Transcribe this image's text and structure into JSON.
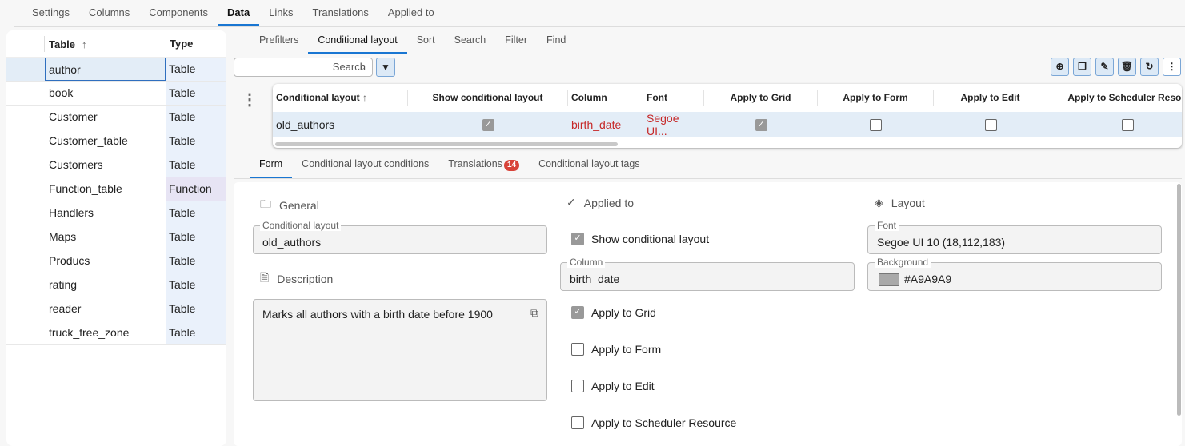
{
  "top_tabs": [
    "Settings",
    "Columns",
    "Components",
    "Data",
    "Links",
    "Translations",
    "Applied to"
  ],
  "left_table": {
    "headers": {
      "table": "Table",
      "type": "Type"
    },
    "rows": [
      {
        "name": "author",
        "type": "Table"
      },
      {
        "name": "book",
        "type": "Table"
      },
      {
        "name": "Customer",
        "type": "Table"
      },
      {
        "name": "Customer_table",
        "type": "Table"
      },
      {
        "name": "Customers",
        "type": "Table"
      },
      {
        "name": "Function_table",
        "type": "Function"
      },
      {
        "name": "Handlers",
        "type": "Table"
      },
      {
        "name": "Maps",
        "type": "Table"
      },
      {
        "name": "Producs",
        "type": "Table"
      },
      {
        "name": "rating",
        "type": "Table"
      },
      {
        "name": "reader",
        "type": "Table"
      },
      {
        "name": "truck_free_zone",
        "type": "Table"
      }
    ]
  },
  "sub_tabs": [
    "Prefilters",
    "Conditional layout",
    "Sort",
    "Search",
    "Filter",
    "Find"
  ],
  "search": {
    "placeholder": "Search"
  },
  "grid": {
    "headers": [
      "Conditional layout",
      "Show conditional layout",
      "Column",
      "Font",
      "Apply to Grid",
      "Apply to Form",
      "Apply to Edit",
      "Apply to Scheduler Resou"
    ],
    "row": {
      "name": "old_authors",
      "show": true,
      "column": "birth_date",
      "font": "Segoe UI...",
      "grid": true,
      "form": false,
      "edit": false,
      "scheduler": false
    }
  },
  "detail_tabs": {
    "form": "Form",
    "conditions": "Conditional layout conditions",
    "translations": "Translations",
    "translations_count": "14",
    "tags": "Conditional layout tags"
  },
  "form": {
    "general": "General",
    "name_label": "Conditional layout",
    "name_value": "old_authors",
    "description_title": "Description",
    "description": "Marks all authors with a birth date before 1900",
    "applied_to": "Applied to",
    "show_label": "Show conditional layout",
    "column_label": "Column",
    "column_value": "birth_date",
    "apply_grid": "Apply to Grid",
    "apply_form": "Apply to Form",
    "apply_edit": "Apply to Edit",
    "apply_scheduler": "Apply to Scheduler Resource",
    "layout": "Layout",
    "font_label": "Font",
    "font_value": "Segoe UI 10 (18,112,183)",
    "background_label": "Background",
    "background_value": "#A9A9A9"
  },
  "colors": {
    "accent": "#1976d2",
    "swatch": "#A9A9A9",
    "red": "#c62828"
  }
}
